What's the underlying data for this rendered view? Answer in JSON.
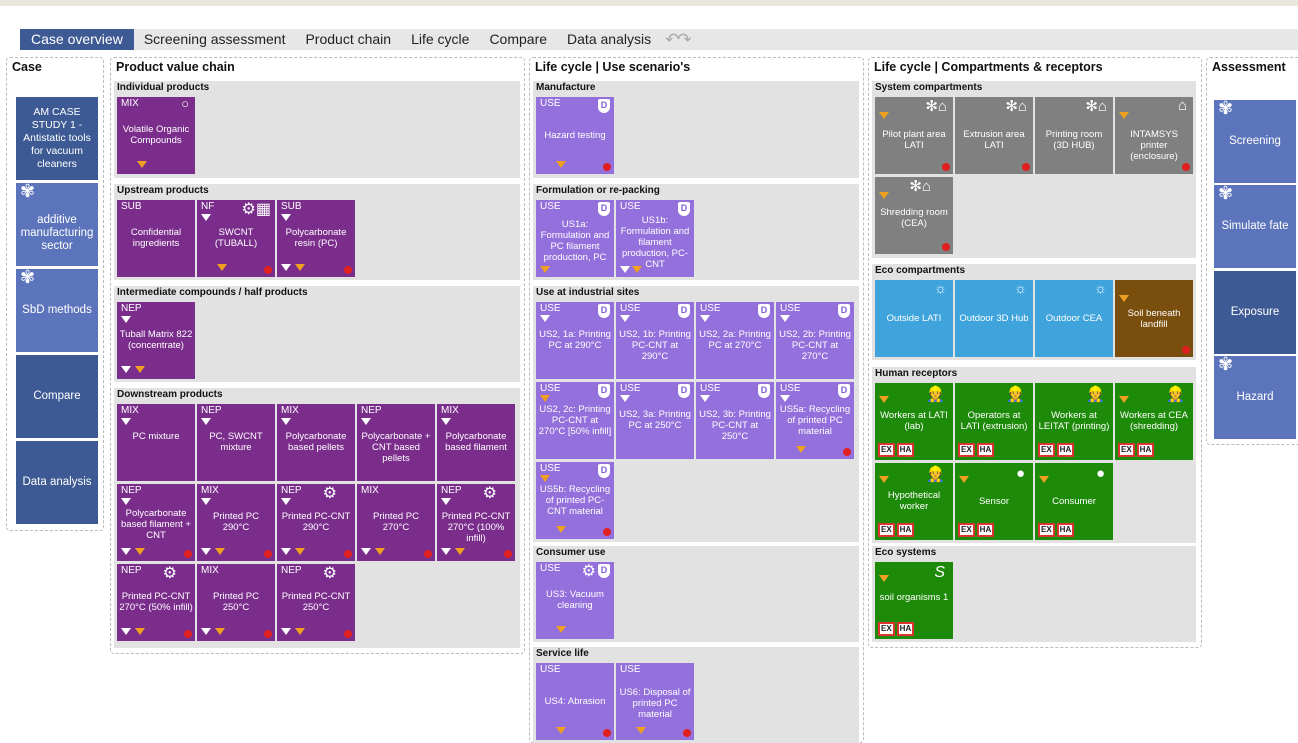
{
  "menu": {
    "items": [
      "Case overview",
      "Screening assessment",
      "Product chain",
      "Life cycle",
      "Compare",
      "Data analysis"
    ],
    "undo": "↶↷"
  },
  "columns": {
    "case": "Case",
    "pvc": "Product value chain",
    "lc": "Life cycle | Use scenario's",
    "comp": "Life cycle | Compartments  & receptors",
    "assess": "Assessment"
  },
  "case_buttons": [
    "AM CASE STUDY 1 - Antistatic tools for vacuum cleaners",
    "additive manufacturing sector",
    "SbD methods",
    "Compare",
    "Data analysis"
  ],
  "pvc": {
    "individual": {
      "title": "Individual products",
      "cards": [
        {
          "tag": "MIX",
          "label": "Volatile Organic Compounds"
        }
      ]
    },
    "upstream": {
      "title": "Upstream products",
      "cards": [
        {
          "tag": "SUB",
          "label": "Confidential ingredients"
        },
        {
          "tag": "NF",
          "label": "SWCNT (TUBALL)"
        },
        {
          "tag": "SUB",
          "label": "Polycarbonate resin (PC)"
        }
      ]
    },
    "intermediate": {
      "title": "Intermediate compounds / half products",
      "cards": [
        {
          "tag": "NEP",
          "label": "Tuball Matrix 822 (concentrate)"
        }
      ]
    },
    "downstream": {
      "title": "Downstream products",
      "cards": [
        {
          "tag": "MIX",
          "label": "PC mixture"
        },
        {
          "tag": "NEP",
          "label": "PC, SWCNT mixture"
        },
        {
          "tag": "MIX",
          "label": "Polycarbonate based pellets"
        },
        {
          "tag": "NEP",
          "label": "Polycarbonate + CNT based pellets"
        },
        {
          "tag": "MIX",
          "label": "Polycarbonate based filament"
        },
        {
          "tag": "NEP",
          "label": "Polycarbonate based filament + CNT"
        },
        {
          "tag": "MIX",
          "label": "Printed PC 290°C"
        },
        {
          "tag": "NEP",
          "label": "Printed PC-CNT 290°C"
        },
        {
          "tag": "MIX",
          "label": "Printed PC 270°C"
        },
        {
          "tag": "NEP",
          "label": "Printed PC-CNT 270°C (100% infill)"
        },
        {
          "tag": "NEP",
          "label": "Printed PC-CNT 270°C (50% infill)"
        },
        {
          "tag": "MIX",
          "label": "Printed PC 250°C"
        },
        {
          "tag": "NEP",
          "label": "Printed PC-CNT 250°C"
        }
      ]
    }
  },
  "lc": {
    "manufacture": {
      "title": "Manufacture",
      "cards": [
        {
          "tag": "USE",
          "label": "Hazard testing"
        }
      ]
    },
    "formulation": {
      "title": "Formulation or re-packing",
      "cards": [
        {
          "tag": "USE",
          "label": "US1a: Formulation and PC filament production, PC"
        },
        {
          "tag": "USE",
          "label": "US1b: Formulation and filament production, PC-CNT"
        }
      ]
    },
    "industrial": {
      "title": "Use at industrial sites",
      "cards": [
        {
          "tag": "USE",
          "label": "US2, 1a: Printing PC at 290°C"
        },
        {
          "tag": "USE",
          "label": "US2, 1b: Printing PC-CNT at 290°C"
        },
        {
          "tag": "USE",
          "label": "US2, 2a: Printing PC at 270°C"
        },
        {
          "tag": "USE",
          "label": "US2, 2b: Printing PC-CNT at 270°C"
        },
        {
          "tag": "USE",
          "label": "US2, 2c: Printing PC-CNT at 270°C [50% infill]"
        },
        {
          "tag": "USE",
          "label": "US2, 3a: Printing PC at 250°C"
        },
        {
          "tag": "USE",
          "label": "US2, 3b: Printing PC-CNT at 250°C"
        },
        {
          "tag": "USE",
          "label": "US5a: Recycling of printed PC material"
        },
        {
          "tag": "USE",
          "label": "US5b: Recycling of printed PC-CNT material"
        }
      ]
    },
    "consumer": {
      "title": "Consumer use",
      "cards": [
        {
          "tag": "USE",
          "label": "US3: Vacuum cleaning"
        }
      ]
    },
    "service": {
      "title": "Service life",
      "cards": [
        {
          "tag": "USE",
          "label": "US4: Abrasion"
        },
        {
          "tag": "USE",
          "label": "US6: Disposal of printed PC material"
        }
      ]
    }
  },
  "comp": {
    "system": {
      "title": "System compartments",
      "cards": [
        "Pilot plant area LATI",
        "Extrusion area LATI",
        "Printing room (3D HUB)",
        "INTAMSYS printer (enclosure)",
        "Shredding room (CEA)"
      ]
    },
    "eco": {
      "title": "Eco compartments",
      "cards": [
        "Outside LATI",
        "Outdoor 3D Hub",
        "Outdoor CEA",
        "Soil beneath landfill"
      ]
    },
    "human": {
      "title": "Human receptors",
      "cards": [
        "Workers at LATI (lab)",
        "Operators at LATI (extrusion)",
        "Workers at LEITAT (printing)",
        "Workers at CEA (shredding)",
        "Hypothetical worker",
        "Sensor",
        "Consumer"
      ]
    },
    "ecosys": {
      "title": "Eco systems",
      "cards": [
        "soil organisms 1"
      ]
    },
    "badges": [
      "EX",
      "HA"
    ]
  },
  "assess_buttons": [
    "Screening",
    "Simulate fate",
    "Exposure",
    "Hazard"
  ],
  "colors": {
    "purple_dark": "#7b2d8c",
    "purple_light": "#9370db",
    "grey": "#808080",
    "blue": "#3fa3dc",
    "brown": "#7a4e0c",
    "green": "#1e8a0a",
    "navy": "#3d5a94",
    "navy_light": "#5c74bb"
  }
}
